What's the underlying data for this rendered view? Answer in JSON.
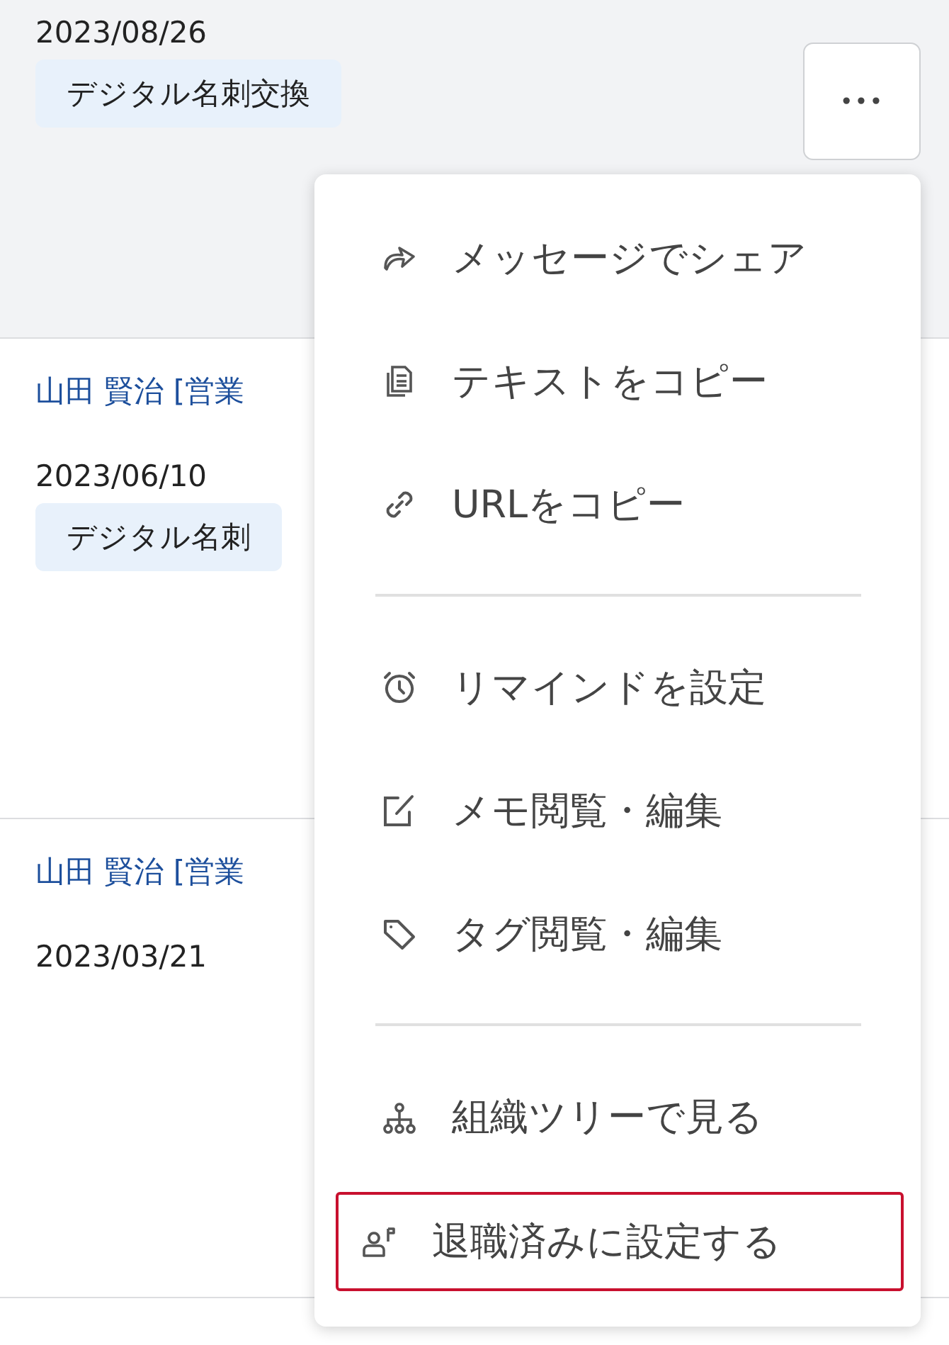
{
  "cards": [
    {
      "selected": true,
      "date": "2023/08/26",
      "tag": "デジタル名刺交換"
    },
    {
      "selected": false,
      "name": "山田 賢治 [営業",
      "date": "2023/06/10",
      "tag": "デジタル名刺"
    },
    {
      "selected": false,
      "name": "山田 賢治 [営業",
      "date": "2023/03/21"
    }
  ],
  "more_button": {
    "label": "•••"
  },
  "menu": {
    "groups": [
      [
        {
          "kind": "share",
          "label": "メッセージでシェア",
          "highlighted": false
        },
        {
          "kind": "copy",
          "label": "テキストをコピー",
          "highlighted": false
        },
        {
          "kind": "link",
          "label": "URLをコピー",
          "highlighted": false
        }
      ],
      [
        {
          "kind": "alarm",
          "label": "リマインドを設定",
          "highlighted": false
        },
        {
          "kind": "memo",
          "label": "メモ閲覧・編集",
          "highlighted": false
        },
        {
          "kind": "tag",
          "label": "タグ閲覧・編集",
          "highlighted": false
        }
      ],
      [
        {
          "kind": "tree",
          "label": "組織ツリーで見る",
          "highlighted": false
        },
        {
          "kind": "retire",
          "label": "退職済みに設定する",
          "highlighted": true
        }
      ]
    ]
  }
}
